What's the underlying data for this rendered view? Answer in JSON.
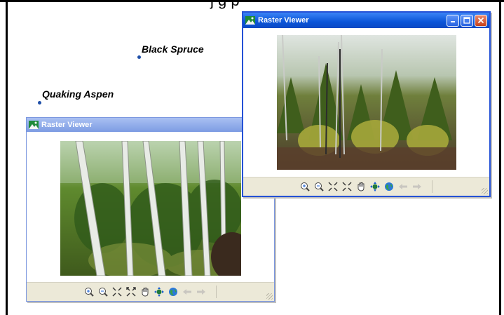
{
  "canvas": {
    "clipped_text": "j                                                                                       g p"
  },
  "map_labels": {
    "black_spruce": "Black Spruce",
    "quaking_aspen": "Quaking Aspen"
  },
  "windows": {
    "aspen_viewer": {
      "title": "Raster Viewer"
    },
    "spruce_viewer": {
      "title": "Raster Viewer"
    }
  },
  "toolbar_icons": [
    "zoom-in-icon",
    "zoom-out-icon",
    "fixed-zoom-in-icon",
    "fixed-zoom-out-icon",
    "pan-icon",
    "full-extent-icon",
    "globe-icon",
    "back-arrow-icon",
    "forward-arrow-icon"
  ],
  "colors": {
    "active_title": "#0a54d8",
    "inactive_title": "#8ea9e8",
    "label_point": "#1f4fa8"
  }
}
